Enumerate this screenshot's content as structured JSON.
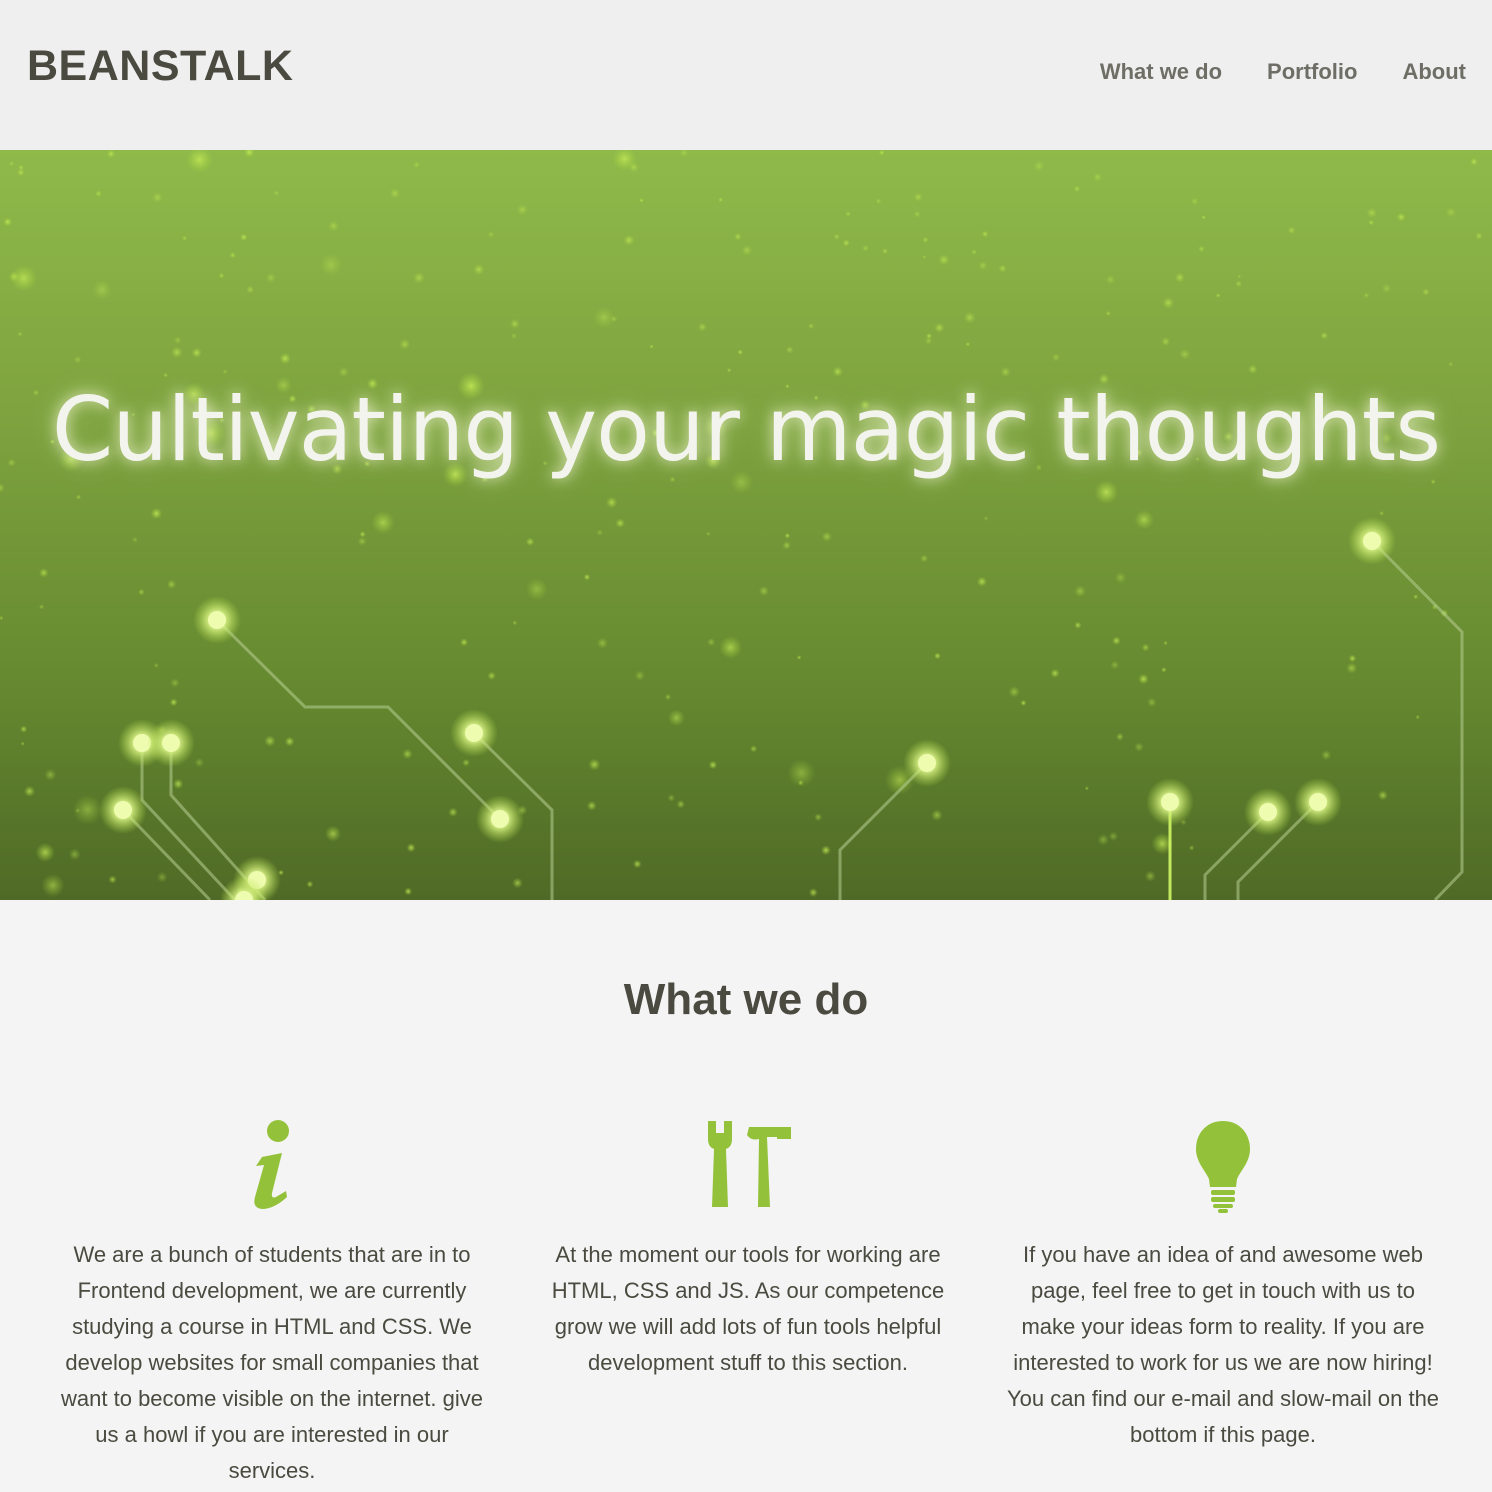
{
  "header": {
    "logo": "BEANSTALK",
    "nav": [
      {
        "label": "What we do"
      },
      {
        "label": "Portfolio"
      },
      {
        "label": "About"
      }
    ]
  },
  "hero": {
    "title": "Cultivating your magic thoughts"
  },
  "section": {
    "title": "What we do",
    "columns": [
      {
        "icon": "info-icon",
        "text": "We are a bunch of students that are in to Frontend development, we are currently studying a course in HTML and CSS. We develop websites for small companies that want to become visible on the internet. give us a howl if you are interested in our services."
      },
      {
        "icon": "tools-icon",
        "text": "At the moment our tools for working are HTML, CSS and JS. As our competence grow we will add lots of fun tools helpful development stuff to this section."
      },
      {
        "icon": "lightbulb-icon",
        "text": "If you have an idea of and awesome web page, feel free to get in touch with us to make your ideas form to reality. If you are interested to work for us we are now hiring! You can find our e-mail and slow-mail on the bottom if this page."
      }
    ]
  },
  "colors": {
    "accent": "#93c23a",
    "text": "#4a4a40",
    "nav": "#6e6e66",
    "hero_top": "#8fba4a",
    "hero_bottom": "#4f6a26"
  }
}
